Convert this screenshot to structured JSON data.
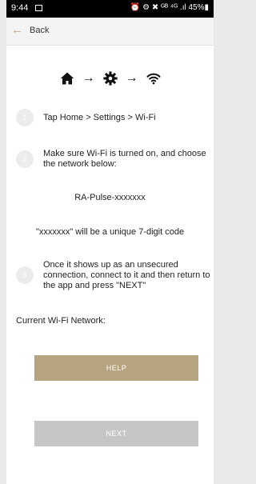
{
  "status_bar": {
    "time": "9:44",
    "right_text": "⏰ ⚙ ✖ ᴳᴮ ⁴ᴳ .ıl 45%▮"
  },
  "header": {
    "back_label": "Back"
  },
  "icons": [
    "home-icon",
    "settings-icon",
    "wifi-icon"
  ],
  "steps": [
    {
      "number": "1",
      "text": "Tap Home > Settings > Wi-Fi"
    },
    {
      "number": "2",
      "text": "Make sure Wi-Fi is turned on, and choose the network below:"
    },
    {
      "number": "3",
      "text": "Once it shows up as an unsecured connection, connect to it and then return to the app and press \"NEXT\""
    }
  ],
  "network_name": "RA-Pulse-xxxxxxx",
  "code_note": "\"xxxxxxx\" will be a unique 7-digit code",
  "current_network_label": "Current Wi-Fi Network:",
  "buttons": {
    "help": "HELP",
    "next": "NEXT"
  },
  "colors": {
    "accent": "#b5a47f",
    "disabled": "#c6c6c6",
    "step_circle": "#ececec"
  }
}
